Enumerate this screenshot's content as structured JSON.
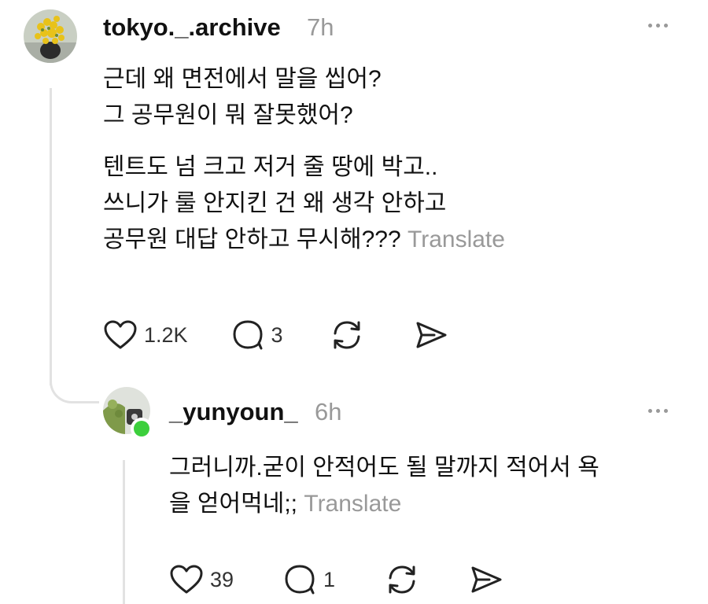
{
  "post": {
    "username": "tokyo._.archive",
    "timestamp": "7h",
    "lines_1": [
      "근데 왜 면전에서 말을 씹어?",
      "그 공무원이 뭐 잘못했어?"
    ],
    "lines_2": [
      "텐트도 넘 크고 저거 줄 땅에 박고..",
      "쓰니가 룰 안지킨 건 왜 생각 안하고"
    ],
    "last_line": "공무원 대답 안하고 무시해???",
    "translate_label": "Translate",
    "like_count": "1.2K",
    "reply_count": "3"
  },
  "reply": {
    "username": "_yunyoun_",
    "timestamp": "6h",
    "lines": [
      "그러니까.굳이 안적어도 될 말까지 적어서 욕"
    ],
    "last_line": "을 얻어먹네;;",
    "translate_label": "Translate",
    "like_count": "39",
    "reply_count": "1",
    "online_status_color": "#3ccf3c"
  },
  "icons": {
    "more": "more-horizontal-icon",
    "like": "heart-icon",
    "reply": "comment-icon",
    "repost": "repost-icon",
    "share": "send-icon"
  }
}
